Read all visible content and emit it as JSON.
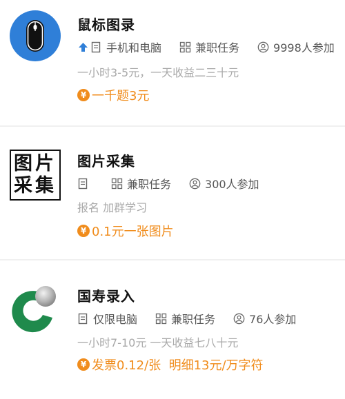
{
  "tasks": [
    {
      "title": "鼠标图录",
      "platform_icon": "arrow-up-icon",
      "platform": "手机和电脑",
      "type": "兼职任务",
      "participants": "9998人参加",
      "description": "一小时3-5元，一天收益二三十元",
      "price": "一千题3元",
      "logo": "mouse-logo",
      "accent": "#2f7fd8"
    },
    {
      "title": "图片采集",
      "platform": "",
      "type": "兼职任务",
      "participants": "300人参加",
      "description": "报名 加群学习",
      "price": "0.1元一张图片",
      "logo": "image-collect-logo",
      "logo_text_1": "图片",
      "logo_text_2": "采集"
    },
    {
      "title": "国寿录入",
      "platform": "仅限电脑",
      "type": "兼职任务",
      "participants": "76人参加",
      "description": "一小时7-10元 一天收益七八十元",
      "price": "发票0.12/张  明细13元/万字符",
      "logo": "china-life-logo",
      "accent": "#1f8a4c"
    }
  ],
  "colors": {
    "price": "#f08c1c",
    "muted": "#a9a9a9",
    "meta": "#555555",
    "divider": "#f0f0f0"
  },
  "coin_symbol": "¥"
}
